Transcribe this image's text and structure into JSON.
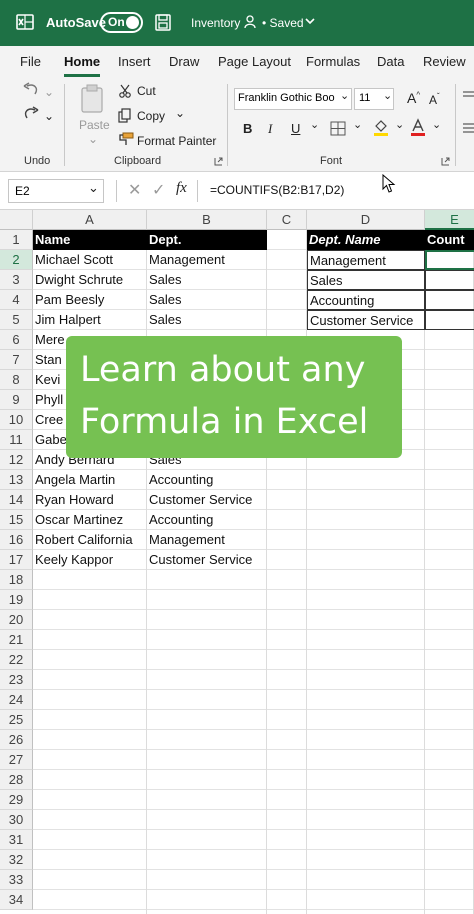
{
  "titlebar": {
    "autosave_label": "AutoSave",
    "toggle_label": "On",
    "filename": "Inventory",
    "saved_status": "• Saved",
    "brand_color": "#1e7145"
  },
  "tabs": [
    "File",
    "Home",
    "Insert",
    "Draw",
    "Page Layout",
    "Formulas",
    "Data",
    "Review"
  ],
  "active_tab": "Home",
  "ribbon": {
    "undo_group": "Undo",
    "clipboard": {
      "paste": "Paste",
      "cut": "Cut",
      "copy": "Copy",
      "format_painter": "Format Painter",
      "group_label": "Clipboard"
    },
    "font": {
      "font_name": "Franklin Gothic Boo",
      "font_size": "11",
      "bold": "B",
      "italic": "I",
      "underline": "U",
      "group_label": "Font"
    }
  },
  "formula_bar": {
    "name_box": "E2",
    "fx": "fx",
    "formula": "=COUNTIFS(B2:B17,D2)"
  },
  "columns": [
    "A",
    "B",
    "C",
    "D",
    "E"
  ],
  "selected_column": "E",
  "rows": [
    "1",
    "2",
    "3",
    "4",
    "5",
    "6",
    "7",
    "8",
    "9",
    "10",
    "11",
    "12",
    "13",
    "14",
    "15",
    "16",
    "17",
    "18",
    "19",
    "20",
    "21",
    "22",
    "23",
    "24",
    "25",
    "26",
    "27",
    "28",
    "29",
    "30",
    "31",
    "32",
    "33",
    "34"
  ],
  "selected_row": "2",
  "table1": {
    "headers": [
      "Name",
      "Dept."
    ],
    "rows": [
      [
        "Michael Scott",
        "Management"
      ],
      [
        "Dwight Schrute",
        "Sales"
      ],
      [
        "Pam Beesly",
        "Sales"
      ],
      [
        "Jim Halpert",
        "Sales"
      ],
      [
        "Mere",
        ""
      ],
      [
        "Stan",
        ""
      ],
      [
        "Kevi",
        ""
      ],
      [
        "Phyll",
        ""
      ],
      [
        "Cree",
        ""
      ],
      [
        "Gabe",
        ""
      ],
      [
        "Andy Bernard",
        "Sales"
      ],
      [
        "Angela Martin",
        "Accounting"
      ],
      [
        "Ryan Howard",
        "Customer Service"
      ],
      [
        "Oscar Martinez",
        "Accounting"
      ],
      [
        "Robert California",
        "Management"
      ],
      [
        "Keely Kappor",
        "Customer Service"
      ]
    ]
  },
  "table2": {
    "headers": [
      "Dept. Name",
      "Count"
    ],
    "rows": [
      "Management",
      "Sales",
      "Accounting",
      "Customer Service"
    ]
  },
  "overlay": {
    "line1": "Learn about any",
    "line2": "Formula in Excel",
    "color": "#76c152"
  }
}
